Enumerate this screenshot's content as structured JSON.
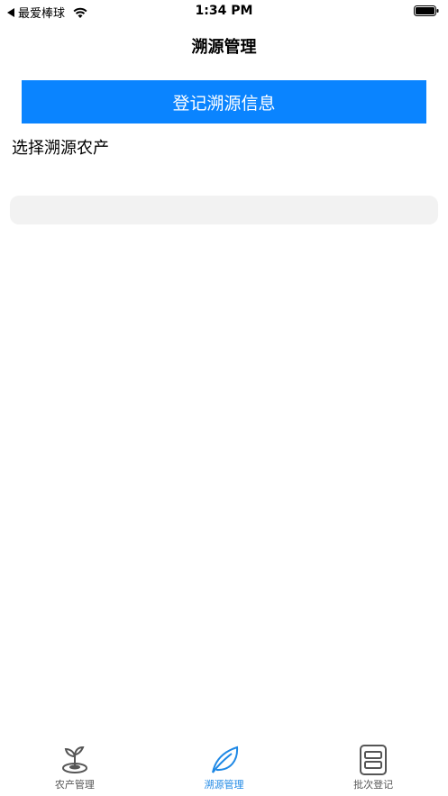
{
  "status_bar": {
    "carrier": "最爱棒球",
    "time": "1:34 PM"
  },
  "nav": {
    "title": "溯源管理"
  },
  "main": {
    "register_button_label": "登记溯源信息",
    "select_label": "选择溯源农产"
  },
  "tab_bar": {
    "tabs": [
      {
        "label": "农产管理",
        "icon": "sprout-icon",
        "active": false
      },
      {
        "label": "溯源管理",
        "icon": "leaf-icon",
        "active": true
      },
      {
        "label": "批次登记",
        "icon": "batch-box-icon",
        "active": false
      }
    ]
  },
  "colors": {
    "accent": "#0a84ff",
    "tab_active": "#1e88e5",
    "tab_inactive": "#555555",
    "select_bg": "#f2f2f2"
  }
}
